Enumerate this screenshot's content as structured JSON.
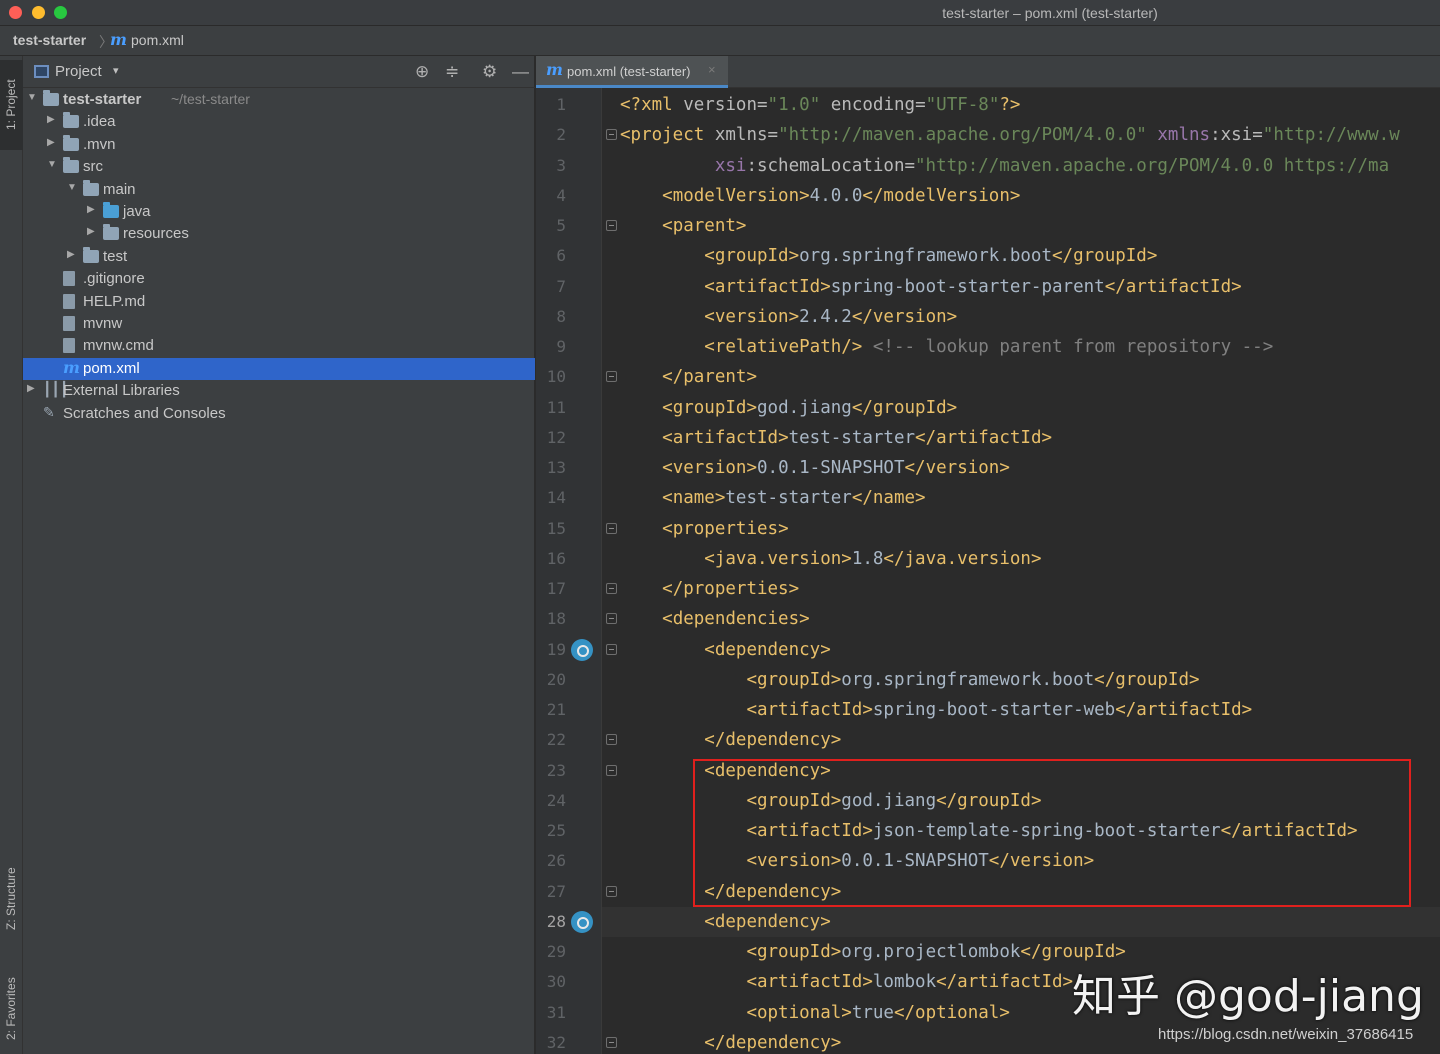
{
  "window": {
    "title": "test-starter – pom.xml (test-starter)"
  },
  "breadcrumb": {
    "root": "test-starter",
    "separator": "〉",
    "file_icon": "m",
    "file": "pom.xml"
  },
  "tool_stripe": {
    "project": "1: Project",
    "structure": "Z: Structure",
    "favorites": "2: Favorites"
  },
  "project_panel": {
    "title": "Project",
    "caret": "▾",
    "tools": [
      "⊕",
      "≑",
      "⚙",
      "—"
    ],
    "tree": [
      {
        "label": "test-starter",
        "suffix": "~/test-starter",
        "arrow": "▼",
        "icon": "module-folder"
      },
      {
        "label": ".idea",
        "arrow": "▶",
        "icon": "folder"
      },
      {
        "label": ".mvn",
        "arrow": "▶",
        "icon": "folder"
      },
      {
        "label": "src",
        "arrow": "▼",
        "icon": "folder"
      },
      {
        "label": "main",
        "arrow": "▼",
        "icon": "folder"
      },
      {
        "label": "java",
        "arrow": "▶",
        "icon": "source-folder"
      },
      {
        "label": "resources",
        "arrow": "▶",
        "icon": "resources-folder"
      },
      {
        "label": "test",
        "arrow": "▶",
        "icon": "folder"
      },
      {
        "label": ".gitignore",
        "arrow": "",
        "icon": "file"
      },
      {
        "label": "HELP.md",
        "arrow": "",
        "icon": "markdown-file"
      },
      {
        "label": "mvnw",
        "arrow": "",
        "icon": "script-file"
      },
      {
        "label": "mvnw.cmd",
        "arrow": "",
        "icon": "file"
      },
      {
        "label": "pom.xml",
        "arrow": "",
        "icon": "maven-file",
        "selected": true
      },
      {
        "label": "External Libraries",
        "arrow": "▶",
        "icon": "library"
      },
      {
        "label": "Scratches and Consoles",
        "arrow": "",
        "icon": "scratches"
      }
    ]
  },
  "editor": {
    "tab": {
      "icon": "m",
      "label": "pom.xml (test-starter)",
      "close": "×"
    },
    "active_line": 28,
    "line_numbers": [
      "1",
      "2",
      "3",
      "4",
      "5",
      "6",
      "7",
      "8",
      "9",
      "10",
      "11",
      "12",
      "13",
      "14",
      "15",
      "16",
      "17",
      "18",
      "19",
      "20",
      "21",
      "22",
      "23",
      "24",
      "25",
      "26",
      "27",
      "28",
      "29",
      "30",
      "31",
      "32"
    ],
    "code": [
      "<?xml version=\"1.0\" encoding=\"UTF-8\"?>",
      "<project xmlns=\"http://maven.apache.org/POM/4.0.0\" xmlns:xsi=\"http://www.w",
      "         xsi:schemaLocation=\"http://maven.apache.org/POM/4.0.0 https://ma",
      "    <modelVersion>4.0.0</modelVersion>",
      "    <parent>",
      "        <groupId>org.springframework.boot</groupId>",
      "        <artifactId>spring-boot-starter-parent</artifactId>",
      "        <version>2.4.2</version>",
      "        <relativePath/> <!-- lookup parent from repository -->",
      "    </parent>",
      "    <groupId>god.jiang</groupId>",
      "    <artifactId>test-starter</artifactId>",
      "    <version>0.0.1-SNAPSHOT</version>",
      "    <name>test-starter</name>",
      "    <properties>",
      "        <java.version>1.8</java.version>",
      "    </properties>",
      "    <dependencies>",
      "        <dependency>",
      "            <groupId>org.springframework.boot</groupId>",
      "            <artifactId>spring-boot-starter-web</artifactId>",
      "        </dependency>",
      "        <dependency>",
      "            <groupId>god.jiang</groupId>",
      "            <artifactId>json-template-spring-boot-starter</artifactId>",
      "            <version>0.0.1-SNAPSHOT</version>",
      "        </dependency>",
      "        <dependency>",
      "            <groupId>org.projectlombok</groupId>",
      "            <artifactId>lombok</artifactId>",
      "            <optional>true</optional>",
      "        </dependency>"
    ],
    "fold_lines": [
      2,
      5,
      10,
      15,
      17,
      18,
      19,
      22,
      23,
      27,
      28,
      32
    ],
    "run_icon_lines": [
      19,
      28
    ],
    "highlighted_range": [
      23,
      27
    ]
  },
  "watermark": {
    "text": "知乎 @god-jiang",
    "url": "https://blog.csdn.net/weixin_37686415"
  },
  "colors": {
    "tag": "#e8bf6a",
    "attr_value": "#6a8759",
    "namespace": "#9876aa",
    "comment": "#808080",
    "text": "#a9b7c6",
    "highlight": "#e0201d",
    "selection": "#2f65ca"
  }
}
